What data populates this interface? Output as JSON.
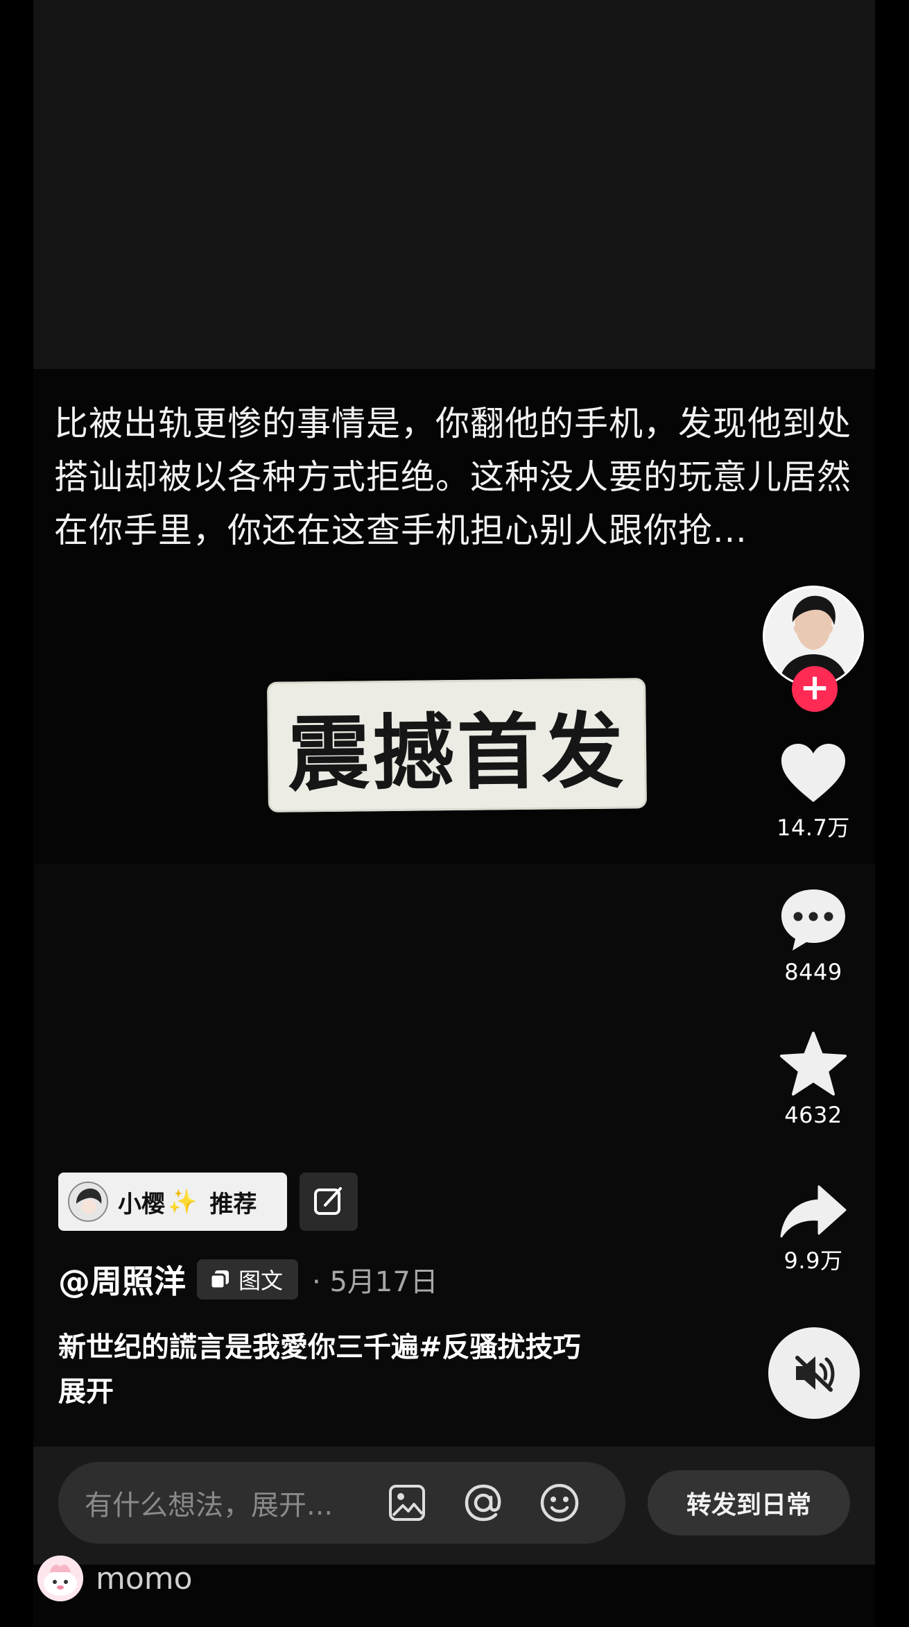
{
  "post": {
    "caption": "比被出轨更惨的事情是，你翻他的手机，发现他到处搭讪却被以各种方式拒绝。这种没人要的玩意儿居然在你手里，你还在这查手机担心别人跟你抢...",
    "sticker_text": "震撼首发",
    "author": "@周照洋",
    "type_badge": "图文",
    "date": "· 5月17日",
    "description_text": "新世纪的謊言是我愛你三千遍",
    "hashtag": "#反骚扰技巧",
    "expand_label": "展开"
  },
  "recommend": {
    "name": "小樱",
    "spark": "✨",
    "label": "推荐"
  },
  "actions": {
    "likes": "14.7万",
    "comments": "8449",
    "favorites": "4632",
    "shares": "9.9万",
    "follow_icon": "plus-icon",
    "mute_icon": "speaker-muted-icon"
  },
  "comment_bar": {
    "placeholder": "有什么想法，展开...",
    "repost_label": "转发到日常"
  },
  "watermark": {
    "text": "momo"
  },
  "colors": {
    "background": "#000000",
    "follow_accent": "#ff2b55",
    "sticker_paper": "#ecece5"
  }
}
